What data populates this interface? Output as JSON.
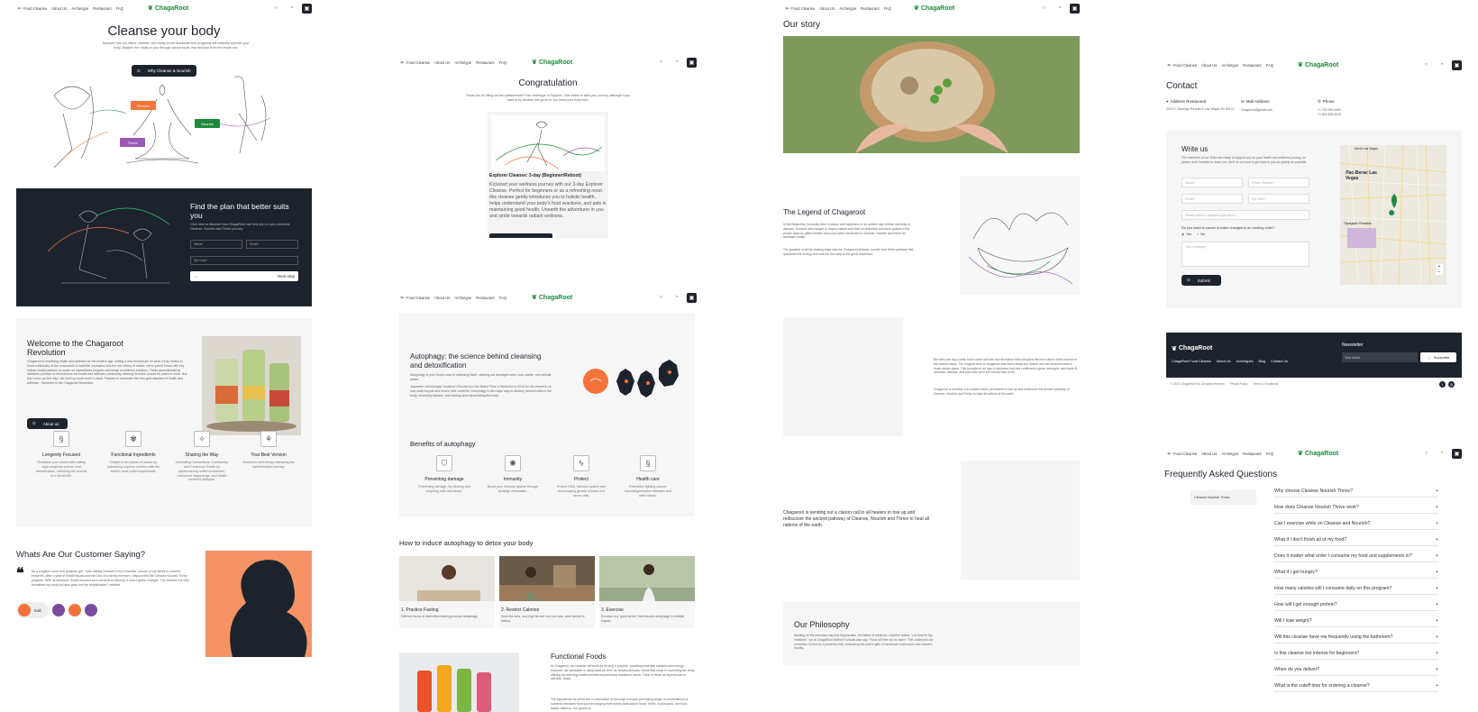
{
  "brand": {
    "name": "ChagaRoot",
    "accent": "#1f8a3e",
    "dark": "#1d232c",
    "orange": "#f4733a"
  },
  "nav": {
    "items": [
      "Food Cleanse",
      "About Us",
      "Archetype",
      "Restaurant",
      "FAQ"
    ],
    "icons": [
      "search-icon",
      "user-icon",
      "cart-icon"
    ]
  },
  "home": {
    "title": "Cleanse your body",
    "subtitle": "Discover how our detox, cleanse, and ready-to-eat functional food programs will radically improve your body. Awaken the vitality in you through natural foods that heal you from the inside out.",
    "cta": "Why Cleanse & Nourish",
    "tags": [
      "Cleanse",
      "Nourish",
      "Thrive"
    ],
    "plan": {
      "title": "Find the plan that better suits you",
      "text": "Click here to discover how ChagaRoot can help you on your personal Cleanse, Nourish and Thrive journey.",
      "name_ph": "Name*",
      "email_ph": "Email*",
      "zip_ph": "Zip Code*",
      "next": "Next step"
    },
    "welcome": {
      "title": "Welcome to the Chagaroot Revolution",
      "text": "Chagaroot is redefining health and wellness for the modern age, setting a new benchmark for what it truly means to thrive holistically. At the crossroads of scientific innovation and the rich history of nature, we've joined forces with key holistic health partners to curate an unparalleled program and range of wellness solutions. These groundbreaking initiatives promise to revolutionize the health and wellness community, steering its future course for years to come. But this is just our first step. We have so much more in store. Prepare to encounter the new gold standard of health and wellness - Welcome to the Chagaroot Revolution.",
      "button": "About us"
    },
    "features": [
      {
        "icon": "longevity-icon",
        "title": "Longevity Focused",
        "text": "Revitalize your health with cutting edge longevity science and detoxification, unlocking the secrets of a vibrant life."
      },
      {
        "icon": "ingredients-icon",
        "title": "Functional Ingredients",
        "text": "Delight in the power of nature by unleashing superior nutrition with the world's most potent superfoods."
      },
      {
        "icon": "sharing-icon",
        "title": "Sharing the Way",
        "text": "Cultivating Connections, Community, and Conscious Health by synchronizing online broadcasts, communal happenings, and health centered dialogue."
      },
      {
        "icon": "best-version-icon",
        "title": "Your Best Version",
        "text": "Ascend to well-being embracing the transformation journey."
      }
    ],
    "testimonial": {
      "title": "Whats Are Our Customer Saying?",
      "quote": "As a longtime mum and potatoes girl, I was initially hesitant to try a cleanse, unsure of my ability to commit. However, after a year of health issues and the loss of a family member, I discovered the Cleanse Nourish Thrive program. With its delicious, recipe-focused and convenient delivery, it was a game-changer. The cleanse not only nourished my body but also gave me the revitalization I needed.",
      "author": "Kali"
    }
  },
  "congrats": {
    "title": "Congratulation",
    "text": "Thank you for filling out the questionnaire! Your archetype is Explorer. Click below to start your journey, although if you want to try another one go for it! You know your body best.",
    "card_title": "Explorer Cleanse: 3-day (Beginner/Reboot)",
    "card_text": "Kickstart your wellness journey with our 3-day Explorer Cleanse. Perfect for beginners or as a refreshing reset, this cleanse gently introduces you to holistic health, helps understand your body's food reactions, and aids in maintaining good health. Unearth the adventurer in you and stride towards radiant wellness."
  },
  "autophagy": {
    "title": "Autophagy: the science behind cleansing and detoxification",
    "text1": "Autophagy is your body's way of cleansing itself, clearing out damaged cells, toxic waste, and cellular waste.",
    "text2": "Japanese cell biologist Yoshinori Ohsumi won the Nobel Prize in Medicine in 2016 for his research on how cells recycle and renew their contents. Autophagy is the major way to destroy harmful cells in the body, reversing disease, and healing and rejuvenating the body.",
    "benefits_title": "Benefits of autophagy",
    "benefits": [
      {
        "icon": "shield-icon",
        "title": "Preventing damage",
        "text": "Preventing damage, by clearing and recycling cells and tissue."
      },
      {
        "icon": "virus-icon",
        "title": "Immunity",
        "text": "Boost your immune system through strategic elimination."
      },
      {
        "icon": "lightning-icon",
        "title": "Protect",
        "text": "Protect DNA, nervous system and encouraging growth of brain and nerve cells."
      },
      {
        "icon": "health-icon",
        "title": "Health care",
        "text": "Potentially fighting cancer, neurodegenerative diseases and other illness."
      }
    ],
    "induce_title": "How to induce autophagy to detox your body",
    "steps": [
      {
        "title": "1. Practice Fasting",
        "text": "Different forms of intermittent fasting promote autophagy."
      },
      {
        "title": "2. Restrict Calories",
        "text": "Diets like keto, very high fat and very low carb, work similar to fasting."
      },
      {
        "title": "3. Exercise",
        "text": "Exercise is a \"good stress\" that induces autophagy in multiple organs."
      }
    ],
    "functional_title": "Functional Foods",
    "functional_text": "At Chagaroot, we consider all foods as serving a purpose, providing essential nutrients and energy. However, we specialize in using what we term as 'functional foods': those that excel in nourishing the body, offering far-reaching health benefits beyond basic nutritional needs. Think of these as superfoods on steroids: foods.",
    "functional_text2": "The ingredients we select are a culmination of thorough research prioritizing single or combinations of nutrients extracted from sources ranging from whole plant-based foods, herbs, mushrooms, and food-based vitamins. Our goal is to"
  },
  "story": {
    "title": "Our story",
    "legend_title": "The Legend of Chagaroot",
    "legend_text1": "In the Beginning, humanity lived in peace and happiness in an ancient age without sickness or disease. Humans were taught to respect nature and their environment and were guided in the proper ways by gifted healers who used plant medicines to Cleanse, Nourish and thrive for abundant health.",
    "legend_text2": "The greatest of all the healing ways was the Chagaroot cleanse, nourish and thrive pathway that quickened life energy and was the first step to the great ascension.",
    "text3": "But then one day a dark force came with lies and deception that corrupted the true nature of life and drove the healers away. The magical elixir of chagaroot was taken away and hidden and the world became a much darker place. This brought on an age of darkness that has continued to grow, emerged, and made ill sickness, disease, and pain was seen the normal way of life.",
    "text4": "Chagaroot is sending out a clarion call to all healers to rise up and rediscover the ancient pathway of Cleanse, Nourish and Thrive to heal all nations of the earth.",
    "clarion": "Chagaroot is sending out a clarion call to all healers to rise up and rediscover the ancient pathway of Cleanse, Nourish and Thrive to heal all nations of the earth.",
    "philosophy_title": "Our Philosophy",
    "philosophy_text": "Building on the premises say that Hippocrates, the father of medicine, might've stated, \"Let food be thy medicine,\" we at ChagaRoot believe it should also say, \"Food will then do no harm.\" This underpins our conviction in food as a powerful elixir, embracing the potent gifts of functional mushrooms and nature's bounty."
  },
  "contact": {
    "title": "Contact",
    "address_label": "Address Restaurant",
    "address": "3315 E Flamingo Rd suite 6 Las Vegas, NV 89121",
    "mail_label": "Mail Address",
    "mail": "Chagaroot@gmail.com",
    "phone_label": "Phone",
    "phone1": "+1 702-992-5400",
    "phone2": "+1 802-809-4005",
    "form_title": "Write us",
    "form_text": "The members of our Team are ready to support you on your health and wellness journey, so please don't hesitate to reach out. We'll do our best to get back to you as quickly as possible.",
    "name_ph": "Name*",
    "phone_ph": "Phone Number*",
    "email_ph": "Email*",
    "zip_ph": "Zip code*",
    "select_ph": "Please select a question type below",
    "question": "Do you need to cancel or make changes to an existing order?",
    "yes": "Yes",
    "no": "No",
    "message_ph": "Your message",
    "submit": "Submit",
    "map_city": "Лас-Вегас Las Vegas",
    "map_small": "North Las Vegas",
    "map_para": "Парадайс Paradise"
  },
  "footer": {
    "links": [
      "ChagaRoot Food Cleanse",
      "About Us",
      "Archetypes",
      "Blog",
      "Contact Us"
    ],
    "newsletter": "Newsletter",
    "email_ph": "Your email",
    "subscribe": "Subscribe",
    "copyright": "© 2023 ChagaRoot Inc. All rights reserved",
    "privacy": "Privacy Policy",
    "terms": "Terms & Conditions"
  },
  "faq": {
    "title": "Frequently Asked Questions",
    "tab": "Cleanse Nourish Thrive",
    "items": [
      "Why choose Cleanse Nourish Thrive?",
      "How does Cleanse Nourish Thrive work?",
      "Can I exercise while on Cleanse and Nourish?",
      "What if I don't finish all of my food?",
      "Does it matter what order I consume my food and supplements in?",
      "What if I get hungry?",
      "How many calories will I consume daily on this program?",
      "How will I get enough protein?",
      "Will I lose weight?",
      "Will this cleanse have me frequently using the bathroom?",
      "Is this cleanse too intense for beginners?",
      "When do you deliver?",
      "What is the cutoff time for ordering a cleanse?"
    ]
  }
}
